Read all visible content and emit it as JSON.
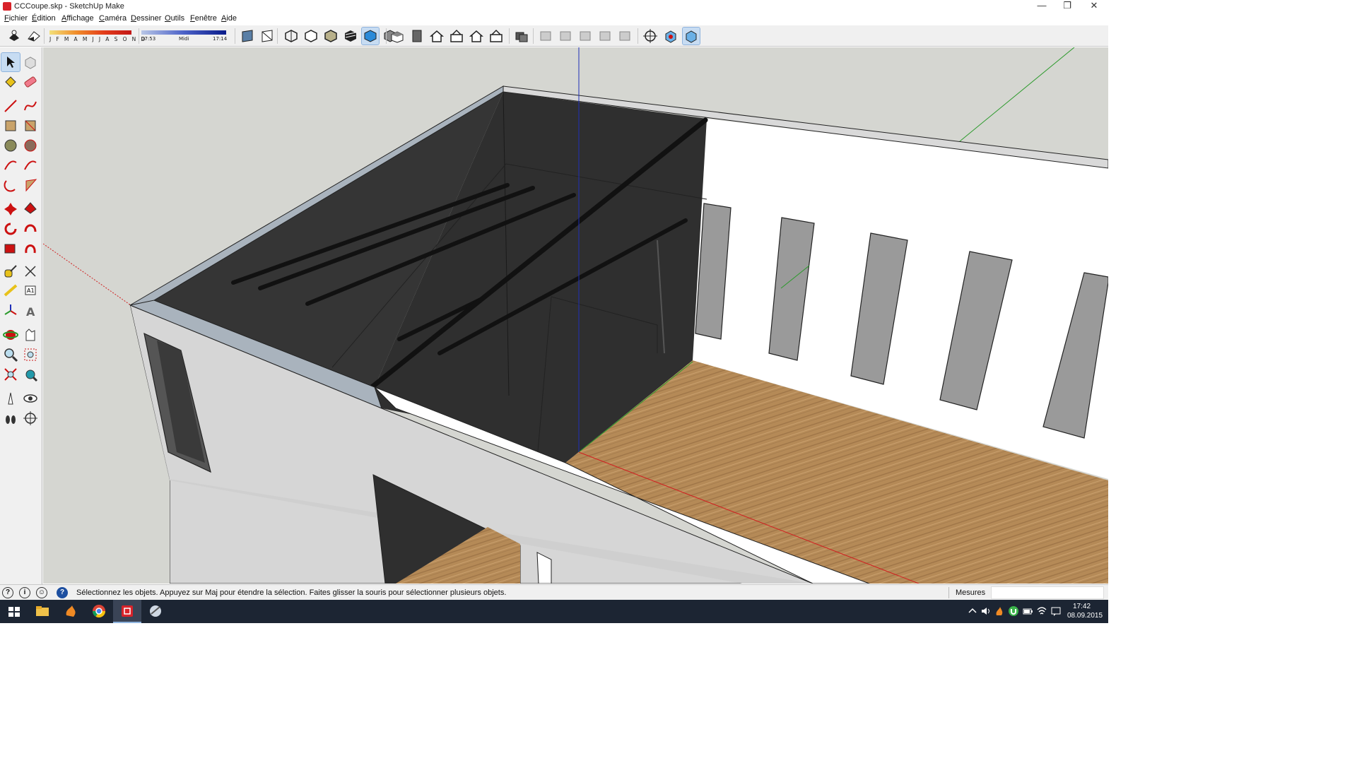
{
  "window": {
    "title": "CCCoupe.skp - SketchUp Make",
    "controls": [
      "—",
      "❐",
      "✕"
    ]
  },
  "menu": [
    "Fichier",
    "Édition",
    "Affichage",
    "Caméra",
    "Dessiner",
    "Outils",
    "Fenêtre",
    "Aide"
  ],
  "shadow_settings": {
    "months_label": "J F M A M J J A S O N D",
    "time_start": "07:53",
    "time_mid": "Midi",
    "time_end": "17:14"
  },
  "toolbar": {
    "groups": [
      [
        "shadows-toggle-icon",
        "fog-toggle-icon"
      ],
      [
        "section-plane-icon",
        "section-fill-icon"
      ],
      [
        "xray-style-icon",
        "wireframe-style-icon",
        "hidden-line-style-icon",
        "shaded-style-icon",
        "shaded-textures-style-icon",
        "monochrome-style-icon"
      ],
      [
        "iso-view-icon",
        "top-view-icon",
        "front-view-icon",
        "right-view-icon",
        "back-view-icon",
        "left-view-icon"
      ],
      [
        "solid-tools-icon"
      ],
      [
        "outer-shell-icon",
        "intersect-icon",
        "union-icon",
        "subtract-icon",
        "trim-icon"
      ],
      [
        "position-camera-icon",
        "add-location-icon",
        "toggle-terrain-icon"
      ]
    ],
    "active": [
      "shaded-textures-style-icon",
      "toggle-terrain-icon"
    ]
  },
  "tools": [
    [
      "select-icon",
      "component-icon"
    ],
    [
      "paint-bucket-icon",
      "eraser-icon"
    ],
    [
      "line-icon",
      "freehand-icon"
    ],
    [
      "rectangle-icon",
      "rotated-rectangle-icon"
    ],
    [
      "circle-icon",
      "polygon-icon"
    ],
    [
      "arc-icon",
      "two-point-arc-icon"
    ],
    [
      "three-point-arc-icon",
      "pie-icon"
    ],
    [
      "move-icon",
      "push-pull-icon"
    ],
    [
      "rotate-icon",
      "follow-me-icon"
    ],
    [
      "scale-icon",
      "offset-icon"
    ],
    [
      "tape-measure-icon",
      "dimension-icon"
    ],
    [
      "protractor-icon",
      "text-icon"
    ],
    [
      "axes-icon",
      "3d-text-icon"
    ],
    [
      "orbit-icon",
      "pan-icon"
    ],
    [
      "zoom-icon",
      "zoom-window-icon"
    ],
    [
      "zoom-extents-icon",
      "previous-view-icon"
    ],
    [
      "position-camera-tool-icon",
      "look-around-icon"
    ],
    [
      "walk-icon",
      "section-plane-tool-icon"
    ]
  ],
  "active_tool": "select-icon",
  "status": {
    "message": "Sélectionnez les objets. Appuyez sur Maj pour étendre la sélection. Faites glisser la souris pour sélectionner plusieurs objets.",
    "measure_label": "Mesures",
    "measure_value": "",
    "icons": [
      "geo-location-icon",
      "credits-icon",
      "user-icon",
      "help-icon"
    ]
  },
  "taskbar": {
    "apps": [
      "windows-start-icon",
      "file-explorer-icon",
      "sketchup-flame-icon",
      "chrome-icon",
      "sketchup-icon",
      "sketchup-layout-icon"
    ],
    "active_app": "sketchup-icon",
    "tray_icons": [
      "tray-up-arrow-icon",
      "volume-icon",
      "flame-tray-icon",
      "utorrent-icon",
      "battery-icon",
      "wifi-icon",
      "notification-icon"
    ],
    "time": "17:42",
    "date": "08.09.2015"
  },
  "colors": {
    "viewport_background": "#d5d6d1",
    "axis_red": "#d02020",
    "axis_green": "#2b9a2b",
    "axis_blue": "#1f2fb8",
    "wall_light": "#d6d6d6",
    "interior_dark": "#303030",
    "floor_wood": "#b58a57",
    "taskbar": "#1c2533",
    "selection_highlight": "#c7dcf2"
  }
}
